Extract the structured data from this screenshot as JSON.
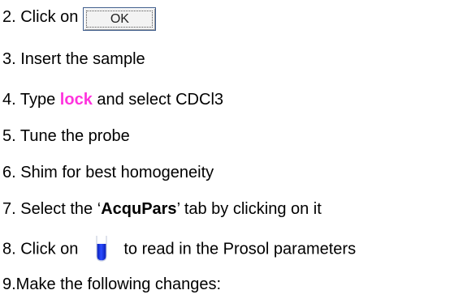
{
  "steps": {
    "step2": {
      "prefix": "2. Click on",
      "button_label": "OK"
    },
    "step3": {
      "text": "3. Insert the sample"
    },
    "step4": {
      "prefix": "4. Type ",
      "keyword": "lock",
      "suffix": " and select CDCl3"
    },
    "step5": {
      "text": "5. Tune the probe"
    },
    "step6": {
      "text": "6. Shim for best homogeneity"
    },
    "step7": {
      "prefix": "7. Select the ‘",
      "tab_name": "AcquPars",
      "suffix": "’ tab by clicking on it"
    },
    "step8": {
      "prefix": "8. Click on",
      "suffix": "to read in the Prosol parameters",
      "icon": "sample-tube-icon"
    },
    "step9": {
      "text": "9.Make the following changes:"
    }
  },
  "colors": {
    "keyword": "#ff33dd",
    "tube_fill": "#1a33e6"
  }
}
